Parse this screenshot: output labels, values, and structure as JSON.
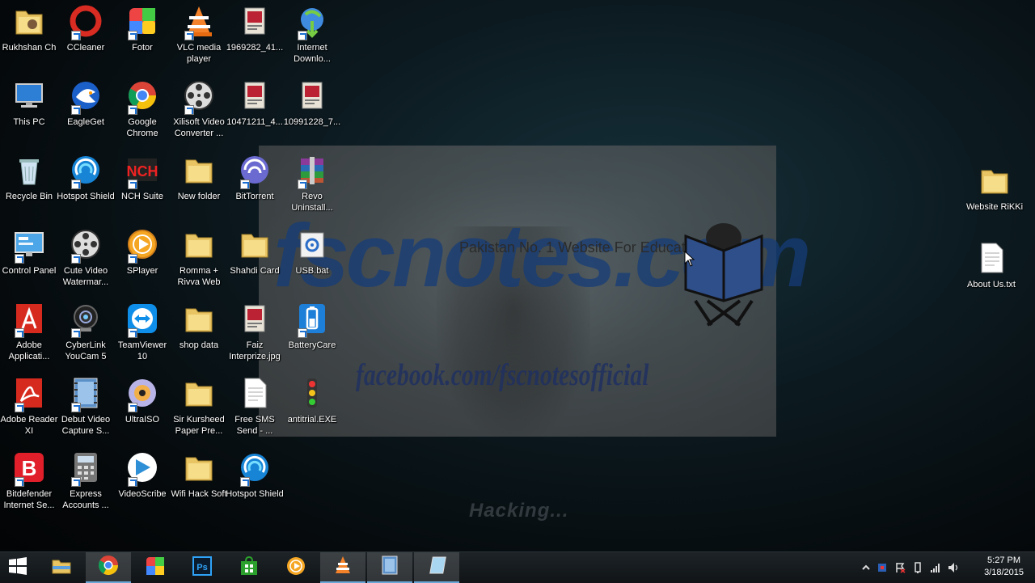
{
  "wallpaper": {
    "caption": "Hacking..."
  },
  "overlay": {
    "tagline": "Pakistan No. 1 Website For Education",
    "logo": "fscnotes.com",
    "facebook": "facebook.com/fscnotesofficial"
  },
  "desktop_icons": [
    {
      "label": "Rukhshan Ch",
      "icon": "user-folder-icon"
    },
    {
      "label": "CCleaner",
      "icon": "ccleaner-icon"
    },
    {
      "label": "Fotor",
      "icon": "fotor-icon"
    },
    {
      "label": "VLC media player",
      "icon": "vlc-icon"
    },
    {
      "label": "1969282_41...",
      "icon": "image-file-icon"
    },
    {
      "label": "Internet Downlo...",
      "icon": "idm-icon"
    },
    {
      "label": "This PC",
      "icon": "computer-icon"
    },
    {
      "label": "EagleGet",
      "icon": "eagleget-icon"
    },
    {
      "label": "Google Chrome",
      "icon": "chrome-icon"
    },
    {
      "label": "Xilisoft Video Converter ...",
      "icon": "film-reel-icon"
    },
    {
      "label": "10471211_4...",
      "icon": "image-file-icon"
    },
    {
      "label": "10991228_7...",
      "icon": "image-file-icon"
    },
    {
      "label": "Recycle Bin",
      "icon": "recycle-bin-icon"
    },
    {
      "label": "Hotspot Shield",
      "icon": "hotspot-shield-icon"
    },
    {
      "label": "NCH Suite",
      "icon": "nch-icon"
    },
    {
      "label": "New folder",
      "icon": "folder-icon"
    },
    {
      "label": "BitTorrent",
      "icon": "bittorrent-icon"
    },
    {
      "label": "Revo Uninstall...",
      "icon": "archive-icon"
    },
    {
      "label": "Control Panel",
      "icon": "control-panel-icon"
    },
    {
      "label": "Cute Video Watermar...",
      "icon": "film-reel-icon"
    },
    {
      "label": "SPlayer",
      "icon": "splayer-icon"
    },
    {
      "label": "Romma + Rivva Web",
      "icon": "folder-icon"
    },
    {
      "label": "Shahdi Card",
      "icon": "folder-icon"
    },
    {
      "label": "USB.bat",
      "icon": "batch-file-icon"
    },
    {
      "label": "Adobe Applicati...",
      "icon": "adobe-icon"
    },
    {
      "label": "CyberLink YouCam 5",
      "icon": "webcam-icon"
    },
    {
      "label": "TeamViewer 10",
      "icon": "teamviewer-icon"
    },
    {
      "label": "shop data",
      "icon": "folder-icon"
    },
    {
      "label": "Faiz Interprize.jpg",
      "icon": "image-file-icon"
    },
    {
      "label": "BatteryCare",
      "icon": "battery-icon"
    },
    {
      "label": "Adobe Reader XI",
      "icon": "adobe-reader-icon"
    },
    {
      "label": "Debut Video Capture S...",
      "icon": "video-capture-icon"
    },
    {
      "label": "UltraISO",
      "icon": "disc-icon"
    },
    {
      "label": "Sir Kursheed Paper Pre...",
      "icon": "folder-icon"
    },
    {
      "label": "Free SMS Send - ...",
      "icon": "text-file-icon"
    },
    {
      "label": "antitrial.EXE",
      "icon": "traffic-light-icon"
    },
    {
      "label": "Bitdefender Internet Se...",
      "icon": "bitdefender-icon"
    },
    {
      "label": "Express Accounts ...",
      "icon": "calculator-icon"
    },
    {
      "label": "VideoScribe",
      "icon": "videoscribe-icon"
    },
    {
      "label": "Wifi Hack Soft",
      "icon": "folder-icon"
    },
    {
      "label": "Hotspot Shield",
      "icon": "hotspot-shield-icon"
    },
    {
      "label": "Website RiKKi",
      "icon": "folder-icon"
    },
    {
      "label": "About Us.txt",
      "icon": "text-file-icon"
    }
  ],
  "taskbar": {
    "items": [
      {
        "name": "start-button",
        "icon": "windows-logo-icon"
      },
      {
        "name": "file-explorer",
        "icon": "folder-icon"
      },
      {
        "name": "google-chrome",
        "icon": "chrome-icon"
      },
      {
        "name": "fotor",
        "icon": "fotor-icon"
      },
      {
        "name": "photoshop",
        "icon": "photoshop-icon"
      },
      {
        "name": "store",
        "icon": "store-icon"
      },
      {
        "name": "splayer",
        "icon": "splayer-icon"
      },
      {
        "name": "vlc",
        "icon": "vlc-icon"
      },
      {
        "name": "debut-video-capture",
        "icon": "video-capture-icon"
      },
      {
        "name": "notepad",
        "icon": "notepad-icon"
      }
    ],
    "clock": {
      "time": "5:27 PM",
      "date": "3/18/2015"
    }
  }
}
